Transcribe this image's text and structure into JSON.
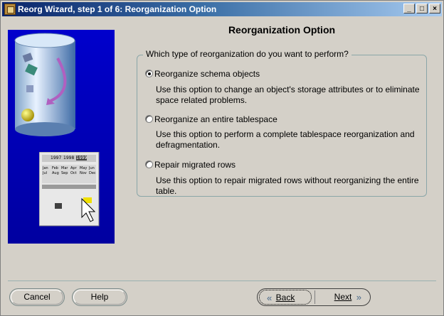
{
  "window": {
    "title": "Reorg Wizard, step 1 of 6: Reorganization Option",
    "controls": {
      "minimize": "_",
      "maximize": "□",
      "close": "×"
    }
  },
  "illustration": {
    "calendar_years": [
      "1997",
      "1998",
      "1999"
    ],
    "months": [
      "Jan",
      "Feb",
      "Mar",
      "Apr",
      "May",
      "Jun",
      "Jul",
      "Aug",
      "Sep",
      "Oct",
      "Nov",
      "Dec"
    ]
  },
  "main": {
    "heading": "Reorganization Option",
    "question": "Which type of reorganization do you want to perform?",
    "options": [
      {
        "label": "Reorganize schema objects",
        "selected": true,
        "description": "Use this option to change an object's storage attributes or to eliminate space related problems."
      },
      {
        "label": "Reorganize an entire tablespace",
        "selected": false,
        "description": "Use this option to perform a complete tablespace reorganization and defragmentation."
      },
      {
        "label": "Repair migrated rows",
        "selected": false,
        "description": "Use this option to repair migrated rows without reorganizing the entire table."
      }
    ]
  },
  "footer": {
    "cancel": "Cancel",
    "help": "Help",
    "back": "Back",
    "next": "Next"
  },
  "colors": {
    "titlebar_start": "#0a246a",
    "titlebar_end": "#a6caf0",
    "window_bg": "#d4d0c8",
    "illustration_bg": "#0000cc"
  },
  "icons": [
    "app-icon",
    "database-cylinder-icon",
    "calendar-icon",
    "cursor-hand-icon",
    "chevron-left-icon",
    "chevron-right-icon"
  ]
}
